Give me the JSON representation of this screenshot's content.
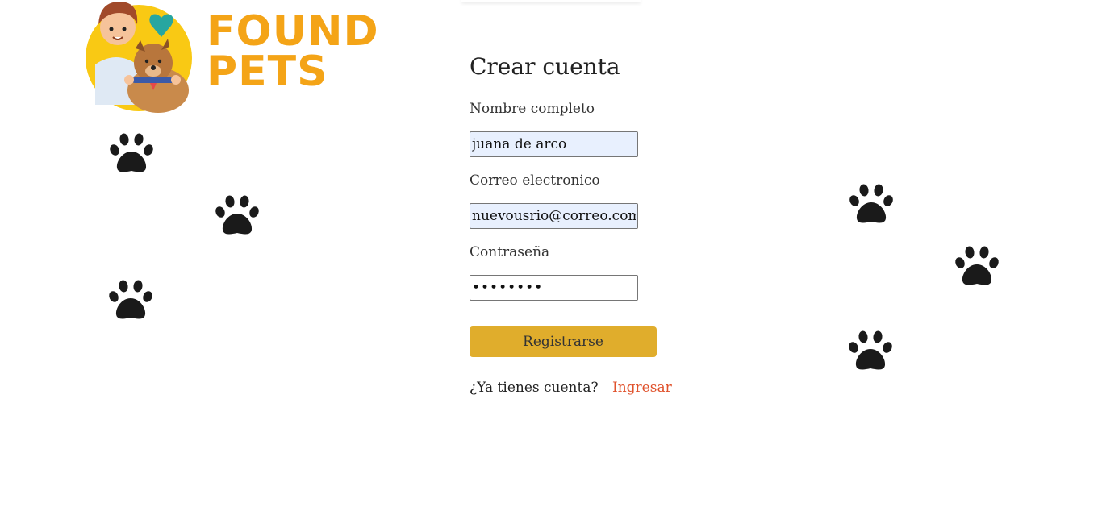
{
  "brand": {
    "line1": "FOUND",
    "line2": "PETS",
    "color": "#f4a417"
  },
  "form": {
    "title": "Crear cuenta",
    "name_label": "Nombre completo",
    "name_value": "juana de arco",
    "email_label": "Correo electronico",
    "email_value": "nuevousrio@correo.com",
    "password_label": "Contraseña",
    "password_value": "••••••••",
    "submit_label": "Registrarse",
    "login_question": "¿Ya tienes cuenta?",
    "login_link": "Ingresar"
  },
  "colors": {
    "button": "#e0ad2c",
    "link": "#e0522c",
    "autofill": "#e8f0fe"
  },
  "decor": {
    "icon": "paw-icon"
  }
}
